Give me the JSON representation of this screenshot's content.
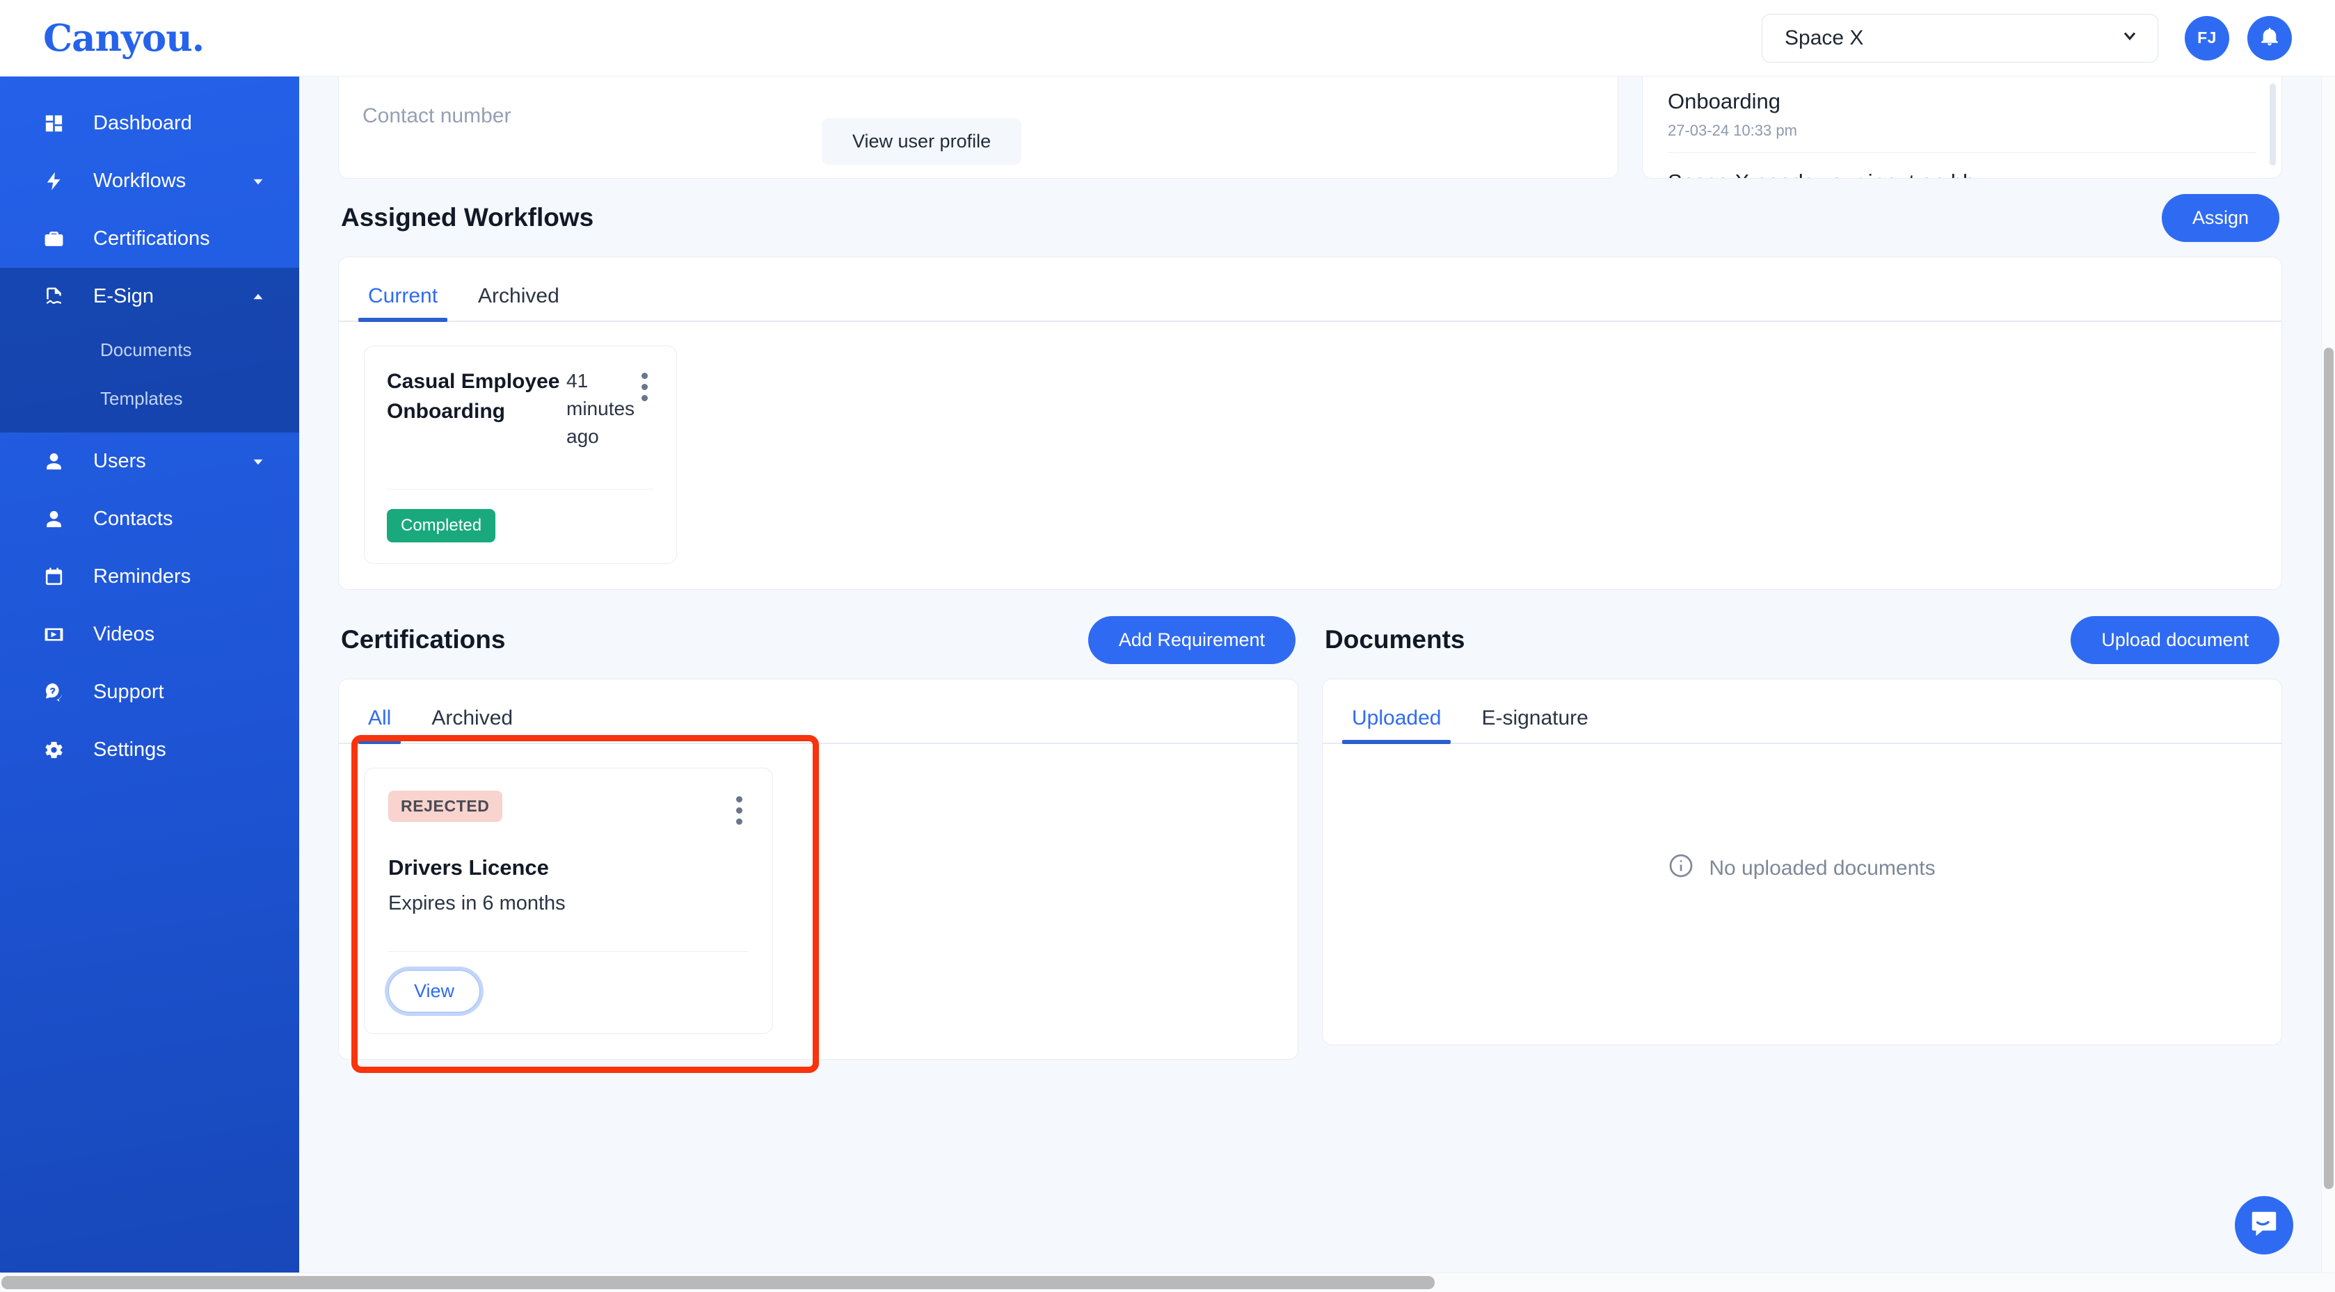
{
  "brand": {
    "name": "Canyou."
  },
  "sidebar": {
    "items": [
      {
        "label": "Dashboard",
        "icon": "dashboard-icon",
        "expandable": false,
        "active": false
      },
      {
        "label": "Workflows",
        "icon": "bolt-icon",
        "expandable": true,
        "expanded": false,
        "active": false
      },
      {
        "label": "Certifications",
        "icon": "briefcase-icon",
        "expandable": false,
        "active": false
      },
      {
        "label": "E-Sign",
        "icon": "document-sign-icon",
        "expandable": true,
        "expanded": true,
        "active": true
      },
      {
        "label": "Users",
        "icon": "user-icon",
        "expandable": true,
        "expanded": false,
        "active": false
      },
      {
        "label": "Contacts",
        "icon": "user-icon",
        "expandable": false,
        "active": false
      },
      {
        "label": "Reminders",
        "icon": "calendar-icon",
        "expandable": false,
        "active": false
      },
      {
        "label": "Videos",
        "icon": "video-icon",
        "expandable": false,
        "active": false
      },
      {
        "label": "Support",
        "icon": "help-chat-icon",
        "expandable": false,
        "active": false
      },
      {
        "label": "Settings",
        "icon": "gear-icon",
        "expandable": false,
        "active": false
      }
    ],
    "esign_submenu": [
      {
        "label": "Documents"
      },
      {
        "label": "Templates"
      }
    ]
  },
  "topbar": {
    "space_selector_value": "Space X",
    "avatar_initials": "FJ",
    "notification_icon": "bell-icon"
  },
  "profile": {
    "contact_number_label": "Contact number",
    "view_profile_label": "View user profile"
  },
  "notifications": {
    "items": [
      {
        "title": "Onboarding",
        "time": "27-03-24 10:33 pm"
      },
      {
        "title": "Space X needs your input on hh",
        "time": ""
      }
    ]
  },
  "workflows": {
    "section_title": "Assigned Workflows",
    "assign_label": "Assign",
    "tabs": [
      {
        "label": "Current",
        "active": true
      },
      {
        "label": "Archived",
        "active": false
      }
    ],
    "cards": [
      {
        "name": "Casual Employee Onboarding",
        "time": "41 minutes ago",
        "status": "Completed",
        "status_color": "#19a97c"
      }
    ]
  },
  "certifications": {
    "section_title": "Certifications",
    "add_requirement_label": "Add Requirement",
    "tabs": [
      {
        "label": "All",
        "active": true
      },
      {
        "label": "Archived",
        "active": false
      }
    ],
    "cards": [
      {
        "status": "REJECTED",
        "status_bg": "#f9d3ce",
        "title": "Drivers Licence",
        "expiry": "Expires in 6 months",
        "view_label": "View",
        "highlighted": true
      }
    ]
  },
  "documents": {
    "section_title": "Documents",
    "upload_label": "Upload document",
    "tabs": [
      {
        "label": "Uploaded",
        "active": true
      },
      {
        "label": "E-signature",
        "active": false
      }
    ],
    "empty_message": "No uploaded documents"
  },
  "chat": {
    "icon": "intercom-messenger-icon"
  },
  "colors": {
    "sidebar_blue": "#2563eb",
    "accent_blue": "#2f6bf2",
    "success_green": "#19a97c",
    "highlight_red": "#f8330d"
  }
}
